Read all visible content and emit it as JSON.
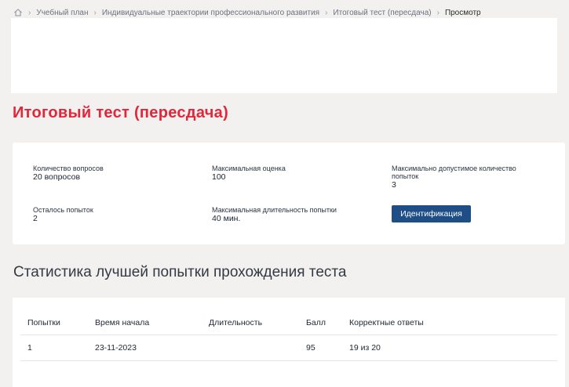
{
  "breadcrumb": {
    "items": [
      "Учебный план",
      "Индивидуальные траектории профессионального развития",
      "Итоговый тест (пересдача)",
      "Просмотр"
    ]
  },
  "page": {
    "title": "Итоговый тест (пересдача)"
  },
  "info": {
    "questions_label": "Количество вопросов",
    "questions_value": "20 вопросов",
    "max_score_label": "Максимальная оценка",
    "max_score_value": "100",
    "max_attempts_label": "Максимально допустимое количество попыток",
    "max_attempts_value": "3",
    "remaining_label": "Осталось попыток",
    "remaining_value": "2",
    "max_duration_label": "Максимальная длительность попытки",
    "max_duration_value": "40 мин.",
    "identify_button": "Идентификация"
  },
  "stats": {
    "title": "Статистика лучшей попытки прохождения теста",
    "columns": [
      "Попытки",
      "Время начала",
      "Длительность",
      "Балл",
      "Корректные ответы"
    ],
    "rows": [
      [
        "1",
        "23-11-2023",
        "",
        "95",
        "19 из 20"
      ]
    ]
  },
  "colors": {
    "title_accent": "#e3263a",
    "button_bg": "#1f4d86",
    "page_bg": "#f2f1ef"
  }
}
